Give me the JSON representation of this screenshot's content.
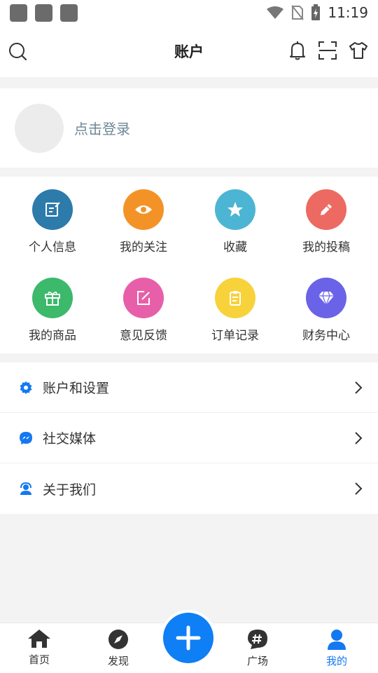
{
  "status_bar": {
    "time": "11:19"
  },
  "header": {
    "title": "账户"
  },
  "login": {
    "prompt": "点击登录"
  },
  "grid": {
    "items": [
      {
        "label": "个人信息",
        "color": "#2c7bab",
        "icon": "profile-edit-icon"
      },
      {
        "label": "我的关注",
        "color": "#f39327",
        "icon": "eye-icon"
      },
      {
        "label": "收藏",
        "color": "#4cb5d3",
        "icon": "star-icon"
      },
      {
        "label": "我的投稿",
        "color": "#ec6a62",
        "icon": "pencil-icon"
      },
      {
        "label": "我的商品",
        "color": "#3cb96a",
        "icon": "gift-icon"
      },
      {
        "label": "意见反馈",
        "color": "#e85fa9",
        "icon": "feedback-edit-icon"
      },
      {
        "label": "订单记录",
        "color": "#f7d23a",
        "icon": "clipboard-icon"
      },
      {
        "label": "财务中心",
        "color": "#6a63e8",
        "icon": "diamond-icon"
      }
    ]
  },
  "menu": {
    "items": [
      {
        "label": "账户和设置",
        "icon": "settings-gear-icon"
      },
      {
        "label": "社交媒体",
        "icon": "messenger-icon"
      },
      {
        "label": "关于我们",
        "icon": "support-agent-icon"
      }
    ]
  },
  "bottom_nav": {
    "items": [
      {
        "label": "首页",
        "icon": "home-icon"
      },
      {
        "label": "发现",
        "icon": "compass-icon"
      },
      {
        "label": "广场",
        "icon": "hashtag-icon"
      },
      {
        "label": "我的",
        "icon": "person-icon",
        "active": true
      }
    ],
    "accent": "#1478f0"
  }
}
